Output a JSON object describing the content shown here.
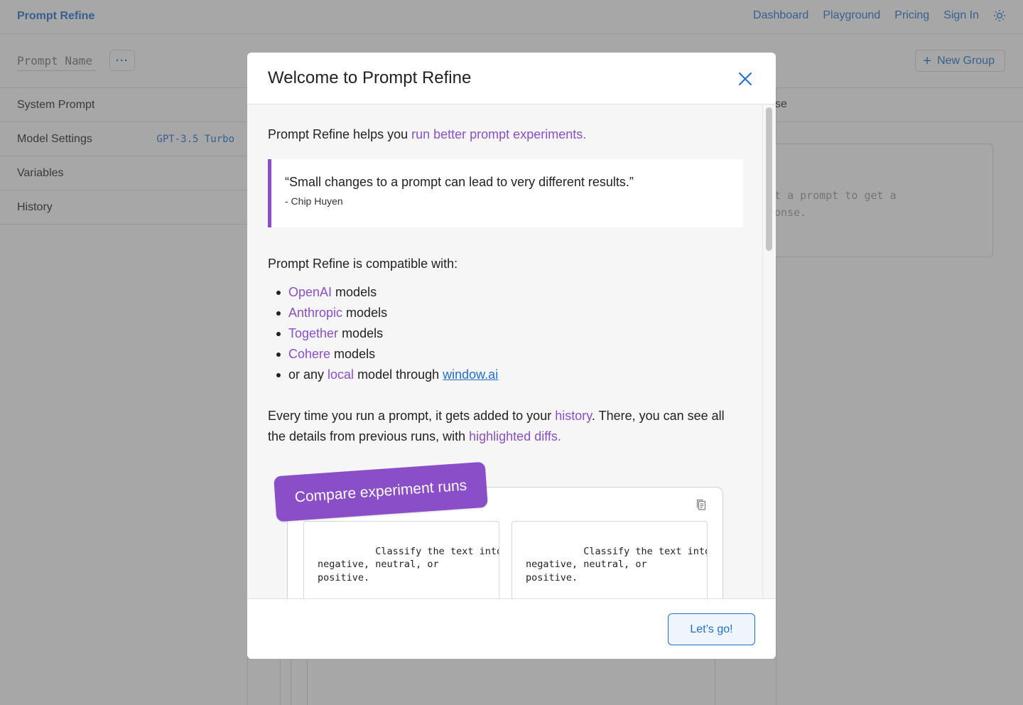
{
  "app": {
    "brand": "Prompt Refine"
  },
  "nav": {
    "dashboard": "Dashboard",
    "playground": "Playground",
    "pricing": "Pricing",
    "signin": "Sign In"
  },
  "toolbar": {
    "prompt_name_placeholder": "Prompt Name",
    "more_label": "···",
    "new_group_label": "New Group"
  },
  "sidebar": {
    "items": [
      {
        "label": "System Prompt",
        "sub": ""
      },
      {
        "label": "Model Settings",
        "sub": "GPT-3.5 Turbo"
      },
      {
        "label": "Variables",
        "sub": ""
      },
      {
        "label": "History",
        "sub": ""
      }
    ]
  },
  "response": {
    "header_fragment": "se",
    "placeholder_line1": "it a prompt to get a",
    "placeholder_line2": "ponse."
  },
  "modal": {
    "title": "Welcome to Prompt Refine",
    "intro_prefix": "Prompt Refine helps you ",
    "intro_highlight": "run better prompt experiments.",
    "quote_text": "“Small changes to a prompt can lead to very different results.”",
    "quote_author": "- Chip Huyen",
    "compat_heading": "Prompt Refine is compatible with:",
    "models": [
      {
        "name": "OpenAI",
        "suffix": " models"
      },
      {
        "name": "Anthropic",
        "suffix": " models"
      },
      {
        "name": "Together",
        "suffix": " models"
      },
      {
        "name": "Cohere",
        "suffix": " models"
      }
    ],
    "local_prefix": "or any ",
    "local_highlight": "local",
    "local_middle": " model through ",
    "local_link": "window.ai",
    "history_part1": "Every time you run a prompt, it gets added to your ",
    "history_link": "history",
    "history_part2": ". There, you can see all the details from previous runs, with ",
    "history_highlight": "highlighted diffs.",
    "compare_badge": "Compare experiment runs",
    "code_left": "Classify the text into\nnegative, neutral, or\npositive.\n\nText: I think the vacation",
    "code_right": "Classify the text into\nnegative, neutral, or\npositive.\n\nText: I think the vacation",
    "button": "Let’s go!"
  },
  "colors": {
    "accent": "#8a4fc8",
    "link": "#1f6fd1",
    "overlay": "#505050"
  }
}
